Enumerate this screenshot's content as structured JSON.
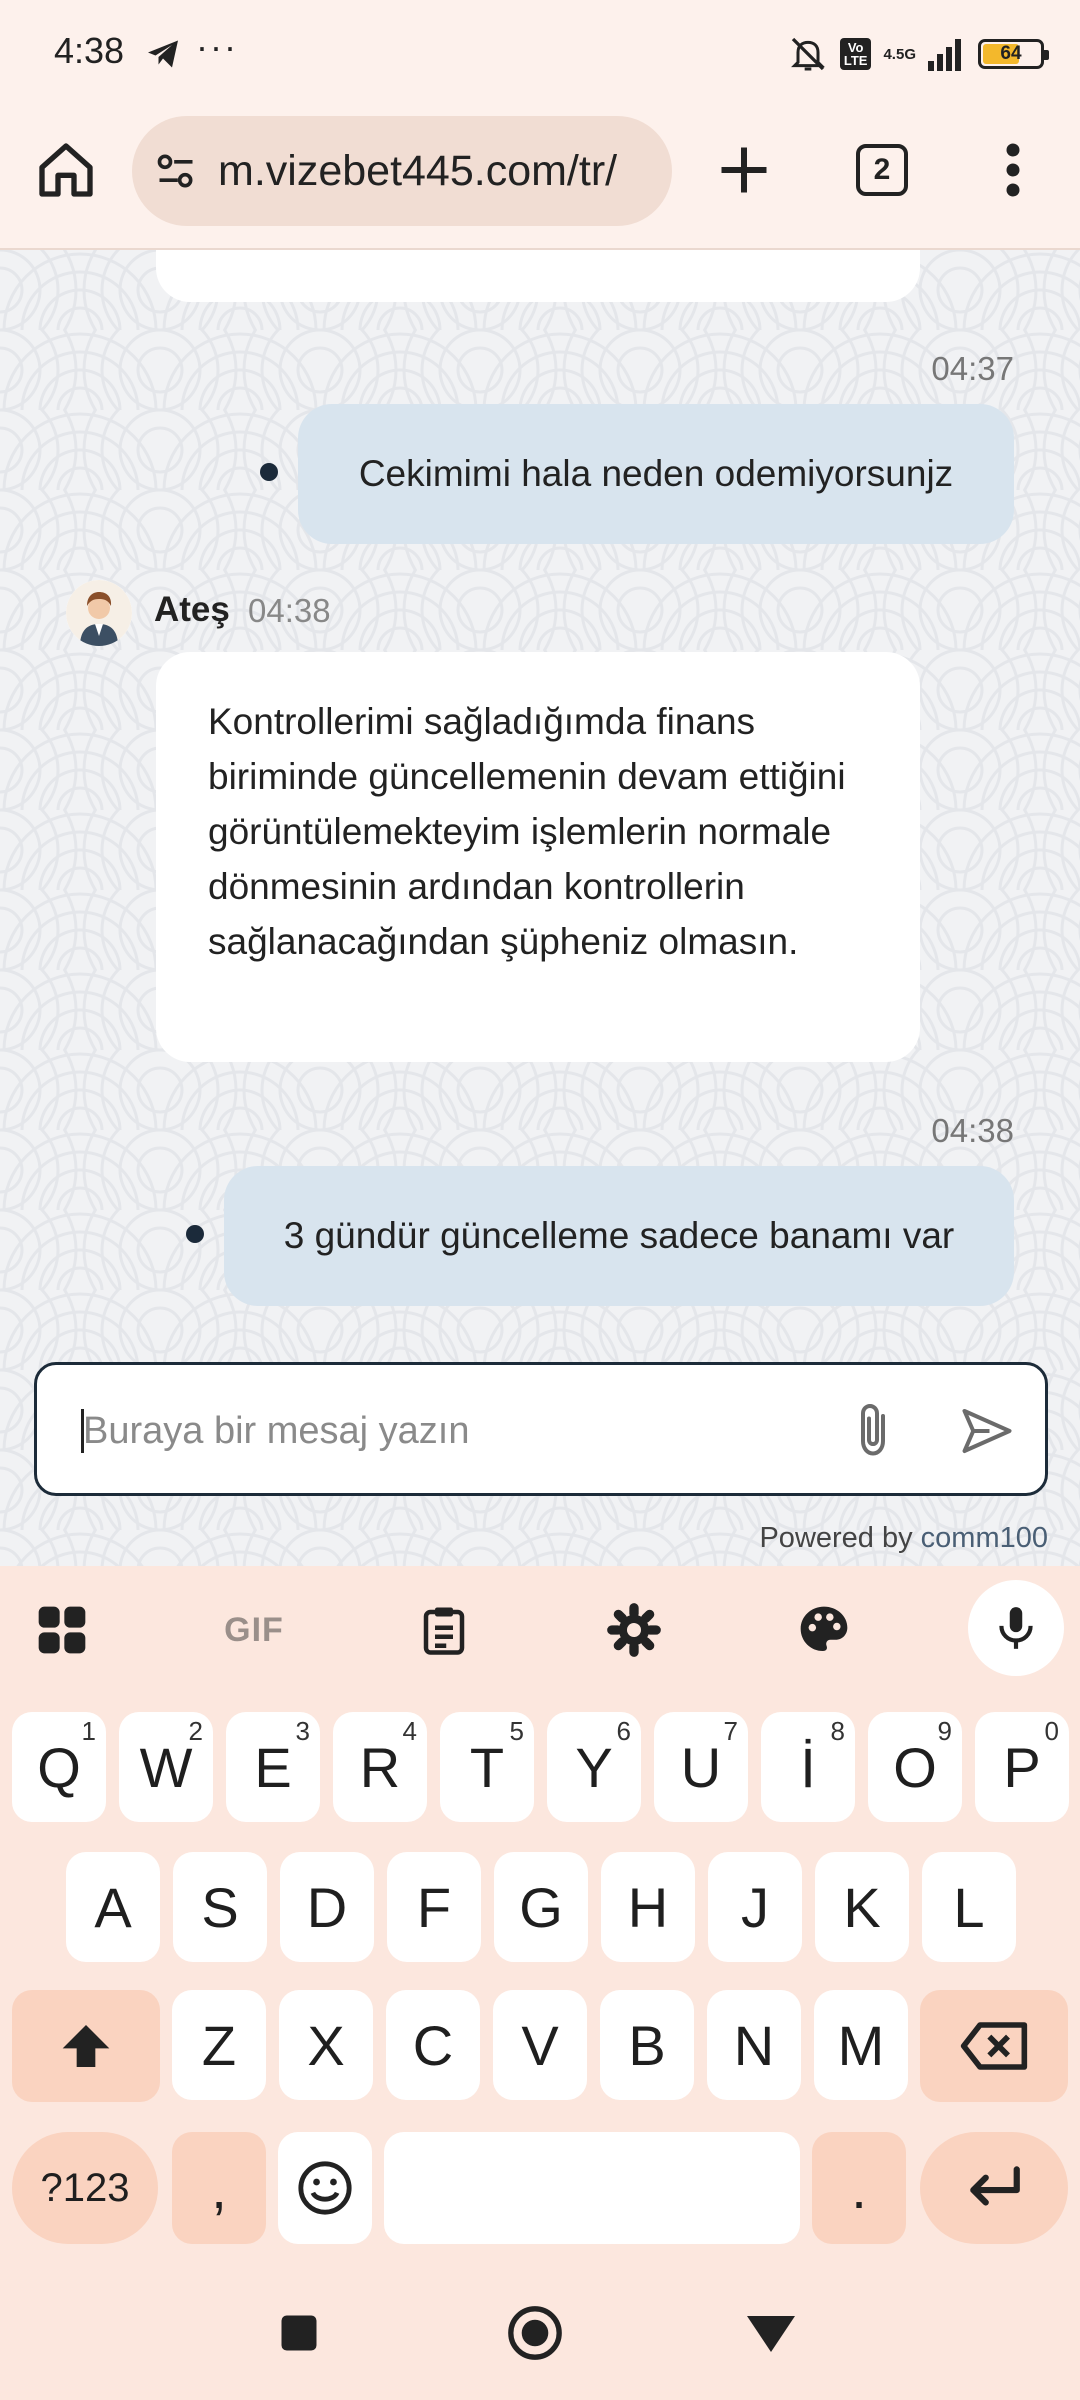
{
  "status_bar": {
    "time": "4:38",
    "dots": "···",
    "volte": "Vo\nLTE",
    "network": "4.5G",
    "battery": "64",
    "battery_level": 0.64,
    "battery_color": "#f3b82c",
    "icons": [
      "telegram-icon",
      "mute-icon",
      "volte-icon",
      "signal-icon",
      "battery-icon"
    ]
  },
  "browser": {
    "url": "m.vizebet445.com/tr/",
    "tab_count": "2",
    "icons": [
      "home-icon",
      "site-settings-icon",
      "new-tab-icon",
      "more-icon"
    ]
  },
  "chat": {
    "messages": [
      {
        "time": "04:37",
        "text": "Cekimimi hala neden odemiyorsunjz"
      },
      {
        "agent": "Ateş",
        "time": "04:38",
        "text": "Kontrollerimi sağladığımda finans biriminde güncellemenin devam ettiğini görüntülemekteyim işlemlerin normale dönmesinin ardından kontrollerin sağlanacağından şüpheniz olmasın."
      },
      {
        "time": "04:38",
        "text": "3 gündür güncelleme sadece banamı var"
      }
    ],
    "input_placeholder": "Buraya bir mesaj yazın",
    "powered_prefix": "Powered by ",
    "powered_brand": "comm100",
    "colors": {
      "outgoing_bubble": "#d8e4ee",
      "incoming_bubble": "#ffffff",
      "input_border": "#1c2b39"
    }
  },
  "keyboard": {
    "toolbar": {
      "gif": "GIF",
      "icons": [
        "apps-icon",
        "clipboard-icon",
        "settings-icon",
        "palette-icon",
        "mic-icon"
      ]
    },
    "row1": [
      {
        "label": "Q",
        "hint": "1"
      },
      {
        "label": "W",
        "hint": "2"
      },
      {
        "label": "E",
        "hint": "3"
      },
      {
        "label": "R",
        "hint": "4"
      },
      {
        "label": "T",
        "hint": "5"
      },
      {
        "label": "Y",
        "hint": "6"
      },
      {
        "label": "U",
        "hint": "7"
      },
      {
        "label": "İ",
        "hint": "8"
      },
      {
        "label": "O",
        "hint": "9"
      },
      {
        "label": "P",
        "hint": "0"
      }
    ],
    "row2": [
      "A",
      "S",
      "D",
      "F",
      "G",
      "H",
      "J",
      "K",
      "L"
    ],
    "row3": [
      "Z",
      "X",
      "C",
      "V",
      "B",
      "N",
      "M"
    ],
    "symbols": "?123",
    "comma": ",",
    "period": ".",
    "accent": "#fad3c0"
  },
  "nav_icons": [
    "recents-icon",
    "home-nav-icon",
    "back-icon"
  ]
}
